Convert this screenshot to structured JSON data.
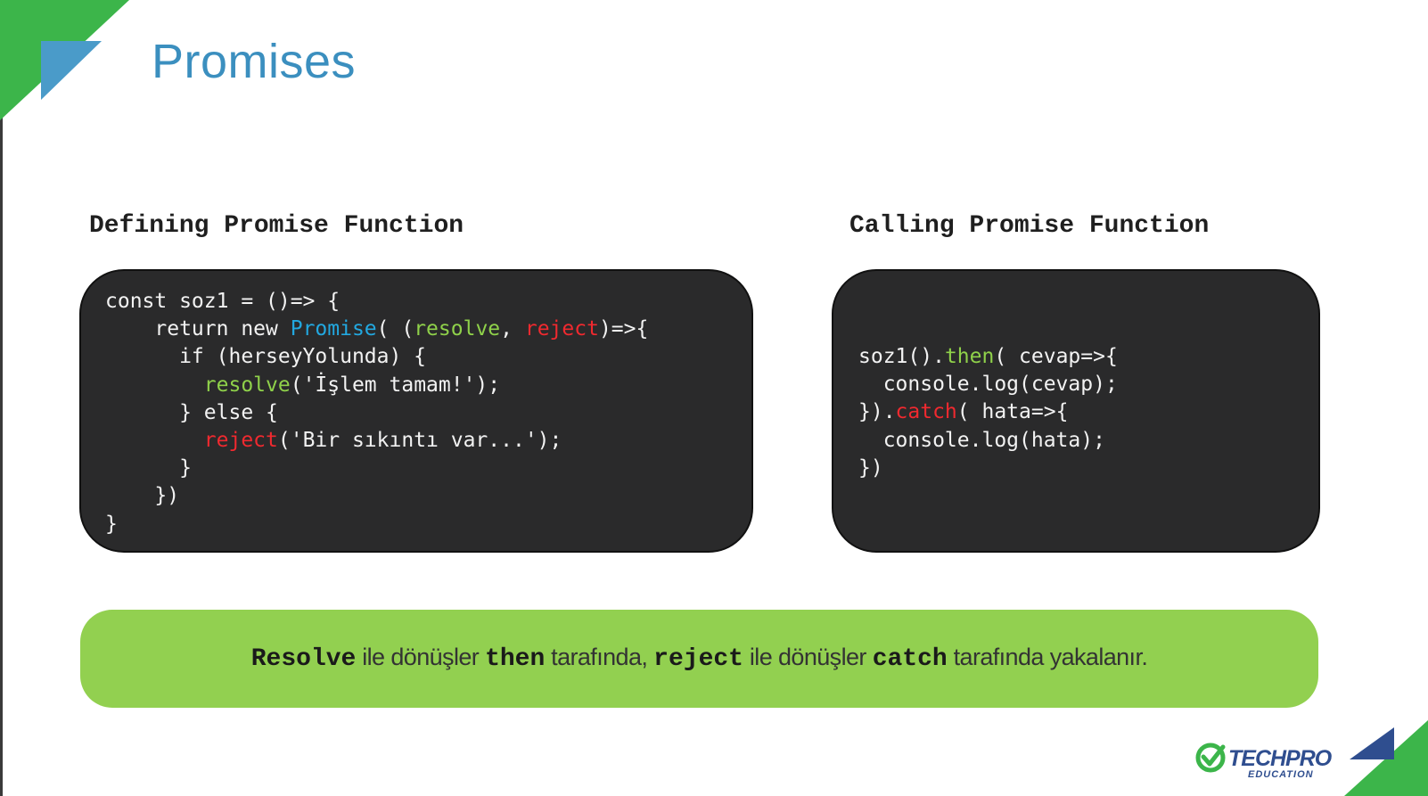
{
  "slide": {
    "title": "Promises"
  },
  "left_panel": {
    "heading": "Defining Promise Function",
    "code": {
      "l1": "const soz1 = ()=> {",
      "l2_a": "    return new ",
      "l2_promise": "Promise",
      "l2_b": "( (",
      "l2_resolve": "resolve",
      "l2_c": ", ",
      "l2_reject": "reject",
      "l2_d": ")=>{",
      "l3": "      if (herseyYolunda) {",
      "l4_indent": "        ",
      "l4_resolve": "resolve",
      "l4_rest": "('İşlem tamam!');",
      "l5": "      } else {",
      "l6_indent": "        ",
      "l6_reject": "reject",
      "l6_rest": "('Bir sıkıntı var...');",
      "l7": "      }",
      "l8": "    })",
      "l9": "}"
    }
  },
  "right_panel": {
    "heading": "Calling Promise Function",
    "code": {
      "l1_a": "soz1().",
      "l1_then": "then",
      "l1_b": "( cevap=>{",
      "l2": "  console.log(cevap);",
      "l3_a": "}).",
      "l3_catch": "catch",
      "l3_b": "( hata=>{",
      "l4": "  console.log(hata);",
      "l5": "})"
    }
  },
  "note": {
    "w1": "Resolve",
    "t1": " ile dönüşler ",
    "w2": "then",
    "t2": " tarafında, ",
    "w3": "reject",
    "t3": " ile dönüşler ",
    "w4": "catch",
    "t4": " tarafında yakalanır."
  },
  "logo": {
    "brand": "TECHPRO",
    "sub": "EDUCATION"
  },
  "colors": {
    "title": "#3b8fbf",
    "code_bg": "#2a2a2b",
    "keyword_blue": "#22a8e0",
    "keyword_green": "#8fd14a",
    "keyword_red": "#f0292f",
    "note_bg": "#92d050",
    "corner_green": "#3cb54a",
    "corner_blue": "#4a9bc9"
  }
}
